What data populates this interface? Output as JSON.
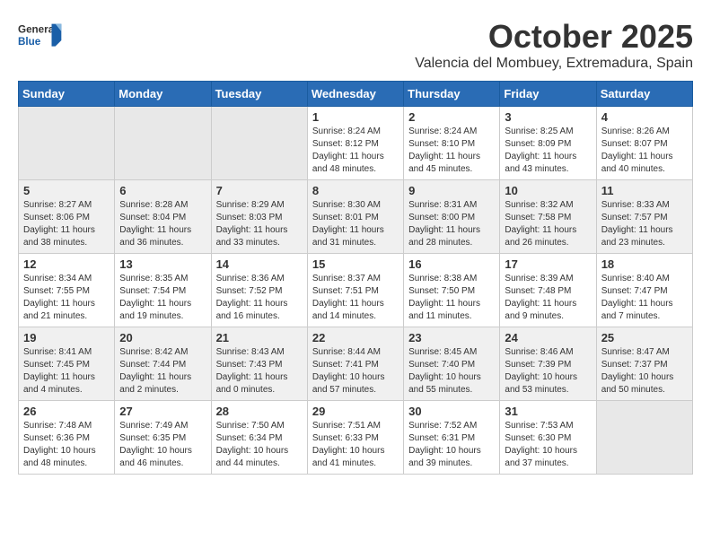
{
  "header": {
    "logo_general": "General",
    "logo_blue": "Blue",
    "month": "October 2025",
    "location": "Valencia del Mombuey, Extremadura, Spain"
  },
  "weekdays": [
    "Sunday",
    "Monday",
    "Tuesday",
    "Wednesday",
    "Thursday",
    "Friday",
    "Saturday"
  ],
  "weeks": [
    [
      {
        "day": "",
        "info": ""
      },
      {
        "day": "",
        "info": ""
      },
      {
        "day": "",
        "info": ""
      },
      {
        "day": "1",
        "info": "Sunrise: 8:24 AM\nSunset: 8:12 PM\nDaylight: 11 hours\nand 48 minutes."
      },
      {
        "day": "2",
        "info": "Sunrise: 8:24 AM\nSunset: 8:10 PM\nDaylight: 11 hours\nand 45 minutes."
      },
      {
        "day": "3",
        "info": "Sunrise: 8:25 AM\nSunset: 8:09 PM\nDaylight: 11 hours\nand 43 minutes."
      },
      {
        "day": "4",
        "info": "Sunrise: 8:26 AM\nSunset: 8:07 PM\nDaylight: 11 hours\nand 40 minutes."
      }
    ],
    [
      {
        "day": "5",
        "info": "Sunrise: 8:27 AM\nSunset: 8:06 PM\nDaylight: 11 hours\nand 38 minutes."
      },
      {
        "day": "6",
        "info": "Sunrise: 8:28 AM\nSunset: 8:04 PM\nDaylight: 11 hours\nand 36 minutes."
      },
      {
        "day": "7",
        "info": "Sunrise: 8:29 AM\nSunset: 8:03 PM\nDaylight: 11 hours\nand 33 minutes."
      },
      {
        "day": "8",
        "info": "Sunrise: 8:30 AM\nSunset: 8:01 PM\nDaylight: 11 hours\nand 31 minutes."
      },
      {
        "day": "9",
        "info": "Sunrise: 8:31 AM\nSunset: 8:00 PM\nDaylight: 11 hours\nand 28 minutes."
      },
      {
        "day": "10",
        "info": "Sunrise: 8:32 AM\nSunset: 7:58 PM\nDaylight: 11 hours\nand 26 minutes."
      },
      {
        "day": "11",
        "info": "Sunrise: 8:33 AM\nSunset: 7:57 PM\nDaylight: 11 hours\nand 23 minutes."
      }
    ],
    [
      {
        "day": "12",
        "info": "Sunrise: 8:34 AM\nSunset: 7:55 PM\nDaylight: 11 hours\nand 21 minutes."
      },
      {
        "day": "13",
        "info": "Sunrise: 8:35 AM\nSunset: 7:54 PM\nDaylight: 11 hours\nand 19 minutes."
      },
      {
        "day": "14",
        "info": "Sunrise: 8:36 AM\nSunset: 7:52 PM\nDaylight: 11 hours\nand 16 minutes."
      },
      {
        "day": "15",
        "info": "Sunrise: 8:37 AM\nSunset: 7:51 PM\nDaylight: 11 hours\nand 14 minutes."
      },
      {
        "day": "16",
        "info": "Sunrise: 8:38 AM\nSunset: 7:50 PM\nDaylight: 11 hours\nand 11 minutes."
      },
      {
        "day": "17",
        "info": "Sunrise: 8:39 AM\nSunset: 7:48 PM\nDaylight: 11 hours\nand 9 minutes."
      },
      {
        "day": "18",
        "info": "Sunrise: 8:40 AM\nSunset: 7:47 PM\nDaylight: 11 hours\nand 7 minutes."
      }
    ],
    [
      {
        "day": "19",
        "info": "Sunrise: 8:41 AM\nSunset: 7:45 PM\nDaylight: 11 hours\nand 4 minutes."
      },
      {
        "day": "20",
        "info": "Sunrise: 8:42 AM\nSunset: 7:44 PM\nDaylight: 11 hours\nand 2 minutes."
      },
      {
        "day": "21",
        "info": "Sunrise: 8:43 AM\nSunset: 7:43 PM\nDaylight: 11 hours\nand 0 minutes."
      },
      {
        "day": "22",
        "info": "Sunrise: 8:44 AM\nSunset: 7:41 PM\nDaylight: 10 hours\nand 57 minutes."
      },
      {
        "day": "23",
        "info": "Sunrise: 8:45 AM\nSunset: 7:40 PM\nDaylight: 10 hours\nand 55 minutes."
      },
      {
        "day": "24",
        "info": "Sunrise: 8:46 AM\nSunset: 7:39 PM\nDaylight: 10 hours\nand 53 minutes."
      },
      {
        "day": "25",
        "info": "Sunrise: 8:47 AM\nSunset: 7:37 PM\nDaylight: 10 hours\nand 50 minutes."
      }
    ],
    [
      {
        "day": "26",
        "info": "Sunrise: 7:48 AM\nSunset: 6:36 PM\nDaylight: 10 hours\nand 48 minutes."
      },
      {
        "day": "27",
        "info": "Sunrise: 7:49 AM\nSunset: 6:35 PM\nDaylight: 10 hours\nand 46 minutes."
      },
      {
        "day": "28",
        "info": "Sunrise: 7:50 AM\nSunset: 6:34 PM\nDaylight: 10 hours\nand 44 minutes."
      },
      {
        "day": "29",
        "info": "Sunrise: 7:51 AM\nSunset: 6:33 PM\nDaylight: 10 hours\nand 41 minutes."
      },
      {
        "day": "30",
        "info": "Sunrise: 7:52 AM\nSunset: 6:31 PM\nDaylight: 10 hours\nand 39 minutes."
      },
      {
        "day": "31",
        "info": "Sunrise: 7:53 AM\nSunset: 6:30 PM\nDaylight: 10 hours\nand 37 minutes."
      },
      {
        "day": "",
        "info": ""
      }
    ]
  ]
}
